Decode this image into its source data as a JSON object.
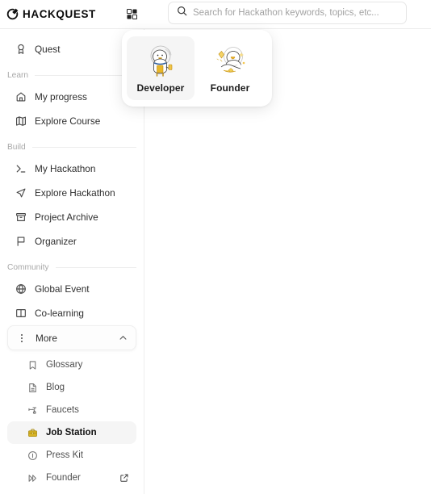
{
  "header": {
    "logo_text": "HACKQUEST",
    "logo_icon": "hackquest-logo-icon",
    "grid_icon": "grid-apps-icon",
    "search": {
      "icon": "search-icon",
      "placeholder": "Search for Hackathon keywords, topics, etc...",
      "value": ""
    }
  },
  "role_popup": {
    "cards": [
      {
        "label": "Developer",
        "icon": "developer-duck-avatar",
        "selected": true
      },
      {
        "label": "Founder",
        "icon": "founder-duck-avatar",
        "selected": false
      }
    ]
  },
  "sidebar": {
    "top_items": [
      {
        "label": "Quest",
        "icon": "medal-icon"
      }
    ],
    "sections": [
      {
        "title": "Learn",
        "items": [
          {
            "label": "My progress",
            "icon": "home-icon"
          },
          {
            "label": "Explore Course",
            "icon": "map-icon"
          }
        ]
      },
      {
        "title": "Build",
        "items": [
          {
            "label": "My Hackathon",
            "icon": "terminal-icon"
          },
          {
            "label": "Explore Hackathon",
            "icon": "navigation-send-icon"
          },
          {
            "label": "Project Archive",
            "icon": "archive-box-icon"
          },
          {
            "label": "Organizer",
            "icon": "flag-icon"
          }
        ]
      },
      {
        "title": "Community",
        "items": [
          {
            "label": "Global Event",
            "icon": "globe-icon"
          },
          {
            "label": "Co-learning",
            "icon": "open-book-icon"
          }
        ]
      }
    ],
    "more": {
      "label": "More",
      "icon": "vertical-dots-icon",
      "chevron": "chevron-up-icon",
      "expanded": true,
      "items": [
        {
          "label": "Glossary",
          "icon": "bookmark-icon",
          "active": false,
          "external": false
        },
        {
          "label": "Blog",
          "icon": "document-icon",
          "active": false,
          "external": false
        },
        {
          "label": "Faucets",
          "icon": "faucet-icon",
          "active": false,
          "external": false
        },
        {
          "label": "Job Station",
          "icon": "briefcase-icon",
          "active": true,
          "external": false
        },
        {
          "label": "Press Kit",
          "icon": "info-circle-icon",
          "active": false,
          "external": false
        },
        {
          "label": "Founder",
          "icon": "double-chevron-right-icon",
          "active": false,
          "external": true,
          "external_icon": "external-link-icon"
        }
      ]
    }
  },
  "colors": {
    "accent_gold": "#c8a415",
    "text_primary": "#0b0b0b",
    "text_secondary": "#4f4f4f",
    "muted": "#a8a8a8",
    "border": "#ededed",
    "active_bg": "#f5f5f5"
  },
  "main": {
    "content": ""
  }
}
